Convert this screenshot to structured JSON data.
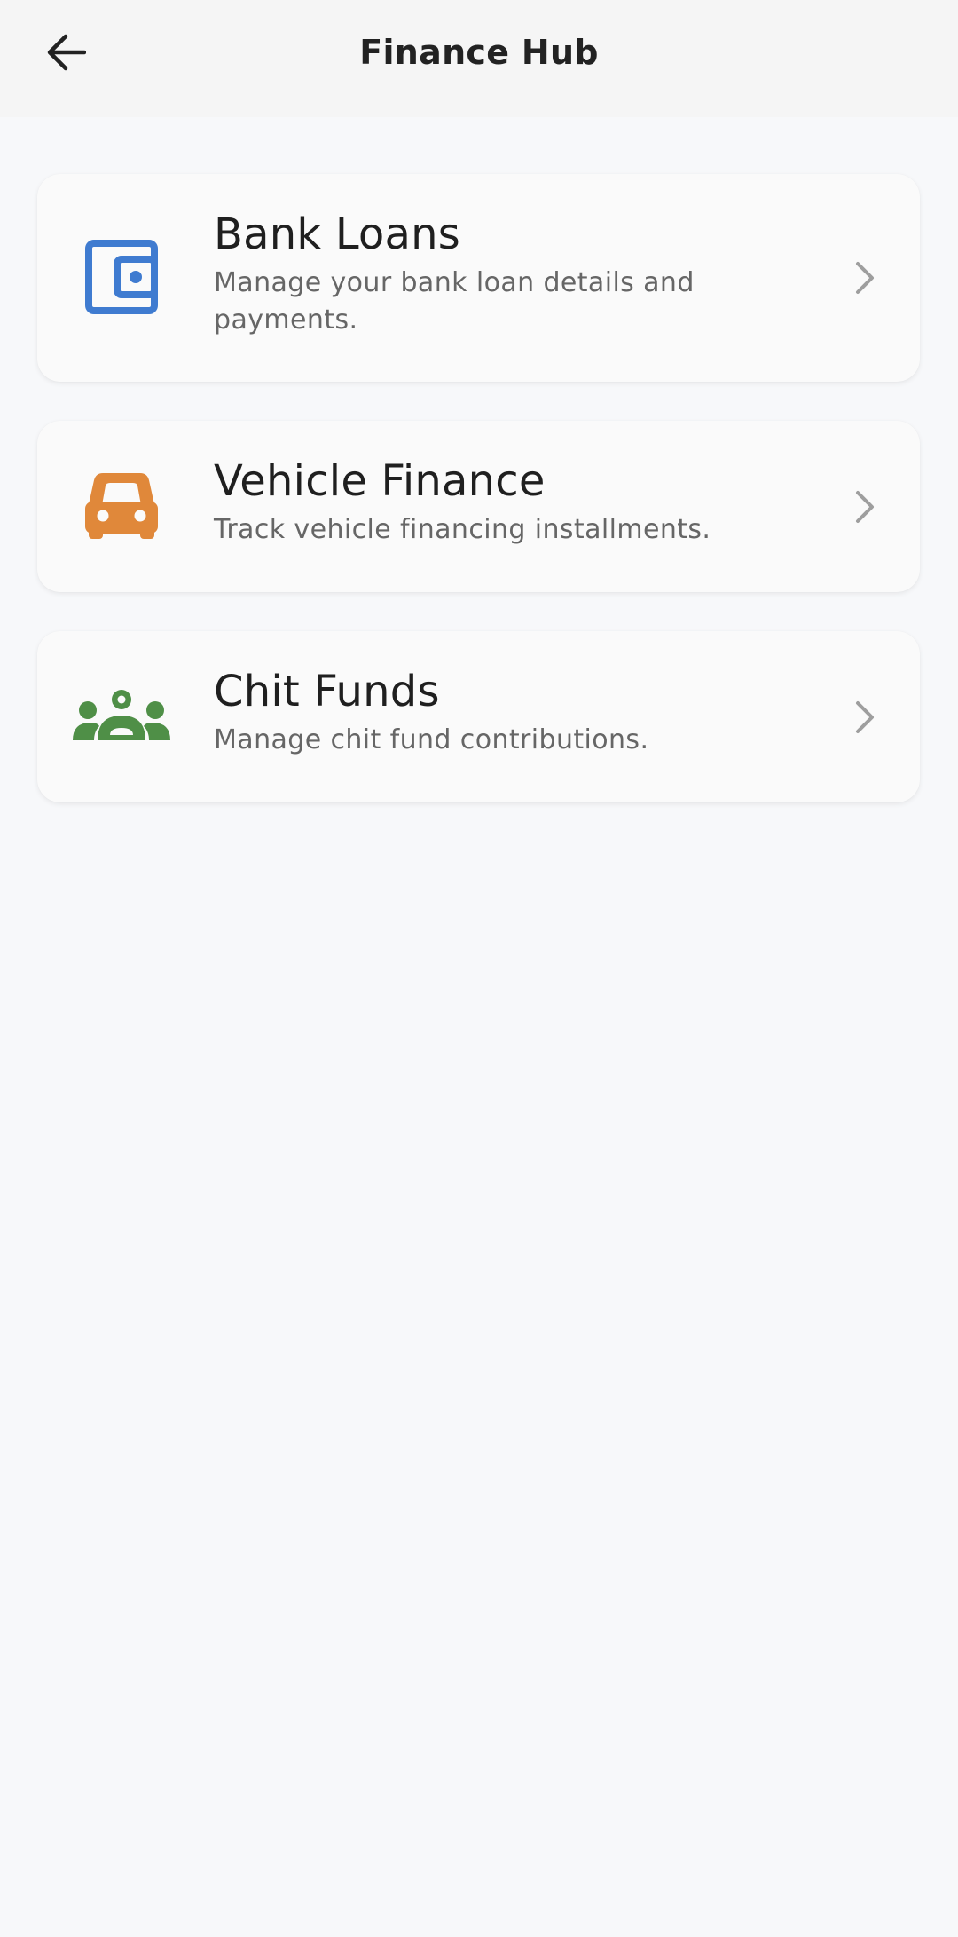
{
  "header": {
    "title": "Finance Hub",
    "back_icon": "arrow-back-icon"
  },
  "cards": [
    {
      "title": "Bank Loans",
      "subtitle": "Manage your bank loan details and payments.",
      "icon": "wallet-icon",
      "color": "#3f7bd0"
    },
    {
      "title": "Vehicle Finance",
      "subtitle": "Track vehicle financing installments.",
      "icon": "car-icon",
      "color": "#e0883a"
    },
    {
      "title": "Chit Funds",
      "subtitle": "Manage chit fund contributions.",
      "icon": "group-icon",
      "color": "#4f8f47"
    }
  ],
  "colors": {
    "background": "#f7f8fa",
    "app_bar": "#f5f5f5",
    "chevron": "#9e9e9e"
  }
}
